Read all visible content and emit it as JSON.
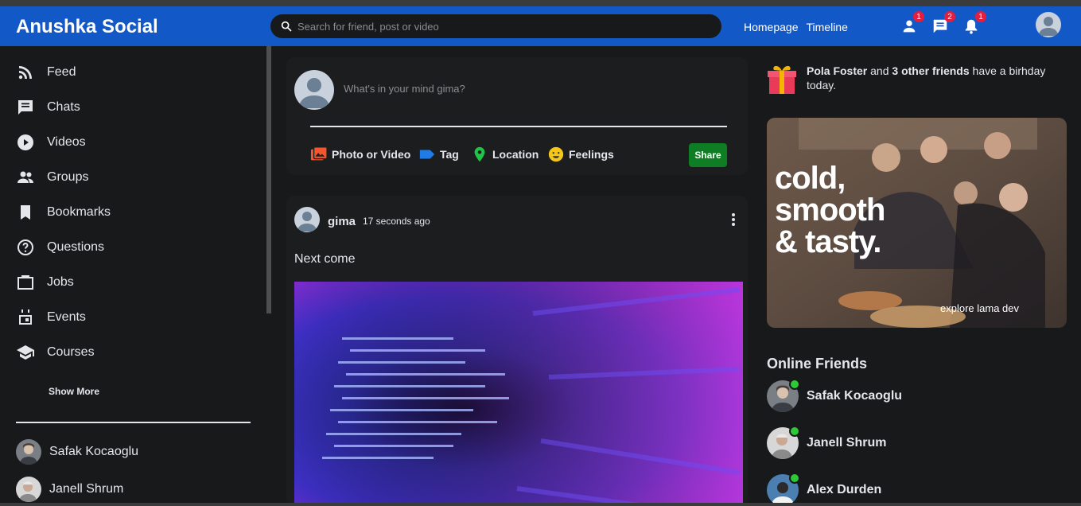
{
  "header": {
    "logo": "Anushka Social",
    "search_placeholder": "Search for friend, post or video",
    "links": [
      "Homepage",
      "Timeline"
    ],
    "badges": {
      "friends": "1",
      "messages": "2",
      "notifications": "1"
    }
  },
  "sidebar": {
    "items": [
      "Feed",
      "Chats",
      "Videos",
      "Groups",
      "Bookmarks",
      "Questions",
      "Jobs",
      "Events",
      "Courses"
    ],
    "show_more": "Show More",
    "friends": [
      "Safak Kocaoglu",
      "Janell Shrum"
    ]
  },
  "share": {
    "placeholder": "What's in your mind gima?",
    "options": [
      "Photo or Video",
      "Tag",
      "Location",
      "Feelings"
    ],
    "button": "Share"
  },
  "post": {
    "username": "gima",
    "time": "17 seconds ago",
    "text": "Next come"
  },
  "rightbar": {
    "birthday_name": "Pola Foster",
    "birthday_mid": " and ",
    "birthday_others": "3 other friends",
    "birthday_tail": " have a birhday today.",
    "ad_headline_1": "cold,",
    "ad_headline_2": "smooth",
    "ad_headline_3": "& tasty.",
    "ad_footer": "explore lama dev",
    "online_title": "Online Friends",
    "online_friends": [
      "Safak Kocaoglu",
      "Janell Shrum",
      "Alex Durden"
    ]
  },
  "colors": {
    "topbar": "#1258c7",
    "online": "#2dc937",
    "share_button": "#0e7d23",
    "badge": "#e41e3f"
  }
}
